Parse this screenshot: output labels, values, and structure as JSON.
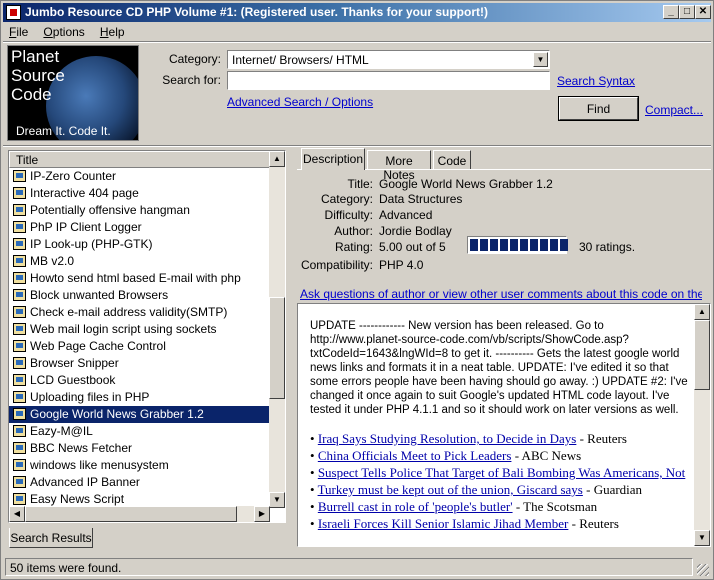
{
  "window": {
    "title": "Jumbo Resource CD PHP Volume #1: (Registered user.  Thanks for your support!)"
  },
  "menu": [
    {
      "label": "File",
      "accel": "F"
    },
    {
      "label": "Options",
      "accel": "O"
    },
    {
      "label": "Help",
      "accel": "H"
    }
  ],
  "logo": {
    "line1": "Planet",
    "line2": "Source",
    "line3": "Code",
    "tagline": "Dream It.  Code It."
  },
  "search": {
    "category_label": "Category:",
    "category_value": "Internet/ Browsers/ HTML",
    "search_label": "Search for:",
    "search_value": "",
    "search_syntax_link": "Search Syntax",
    "advanced_link": "Advanced Search / Options",
    "find_button": "Find",
    "compact_link": "Compact..."
  },
  "results": {
    "column_title": "Title",
    "items": [
      "IP-Zero Counter",
      "Interactive 404 page",
      "Potentially offensive hangman",
      "PhP IP Client Logger",
      "IP Look-up (PHP-GTK)",
      "MB v2.0",
      "Howto send html based E-mail with php",
      "Block unwanted Browsers",
      "Check e-mail address validity(SMTP)",
      "Web mail login script using sockets",
      "Web Page Cache Control",
      "Browser Snipper",
      "LCD Guestbook",
      "Uploading files in PHP",
      "Google World News Grabber 1.2",
      "Eazy-M@IL",
      "BBC News Fetcher",
      "windows like menusystem",
      "Advanced IP Banner",
      "Easy News Script"
    ],
    "selected_index": 14,
    "tab_label": "Search Results"
  },
  "tabs": [
    "Description",
    "More Notes",
    "Code"
  ],
  "details": {
    "title_label": "Title:",
    "title": "Google World News Grabber 1.2",
    "category_label": "Category:",
    "category": "Data Structures",
    "difficulty_label": "Difficulty:",
    "difficulty": "Advanced",
    "author_label": "Author:",
    "author": "Jordie Bodlay",
    "rating_label": "Rating:",
    "rating": "5.00 out of 5",
    "rating_fraction": 1.0,
    "ratings_count": "30 ratings.",
    "compat_label": "Compatibility:",
    "compatibility": "PHP 4.0",
    "ask_link": "Ask questions of author or view other user comments about this code on the web..."
  },
  "content": {
    "update_text": "UPDATE ------------ New version has been released. Go to http://www.planet-source-code.com/vb/scripts/ShowCode.asp?txtCodeId=1643&lngWId=8 to get it. ---------- Gets the latest google world news links and formats it in a neat table. UPDATE: I've edited it so that some errors people have been having should go away. :) UPDATE #2: I've changed it once again to suit Google's updated HTML code layout. I've tested it under PHP 4.1.1 and so it should work on later versions as well.",
    "news": [
      {
        "headline": "Iraq Says Studying Resolution, to Decide in Days",
        "source": " - Reuters"
      },
      {
        "headline": "China Officials Meet to Pick Leaders",
        "source": " - ABC News"
      },
      {
        "headline": "Suspect Tells Police That Target of Bali Bombing Was Americans, Not",
        "source": ""
      },
      {
        "headline": "Turkey must be kept out of the union, Giscard says",
        "source": " - Guardian"
      },
      {
        "headline": "Burrell cast in role of 'people's butler'",
        "source": " - The Scotsman"
      },
      {
        "headline": "Israeli Forces Kill Senior Islamic Jihad Member",
        "source": " - Reuters"
      }
    ]
  },
  "status": {
    "text": "50 items were found."
  }
}
